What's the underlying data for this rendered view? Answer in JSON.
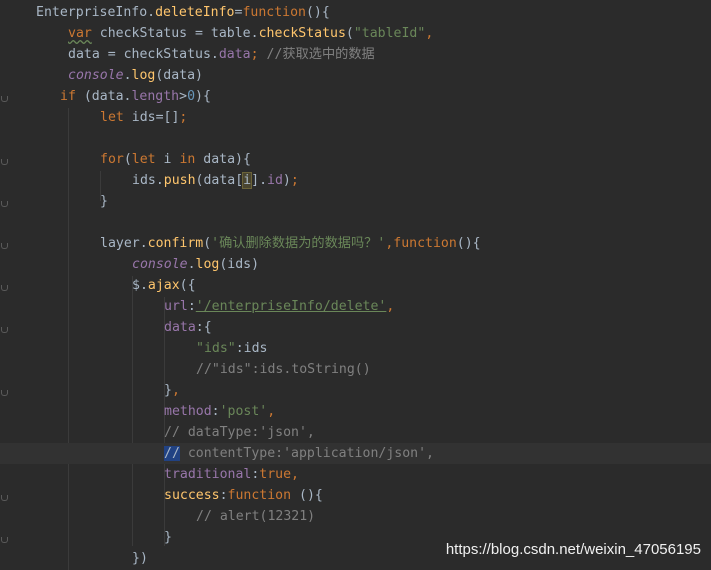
{
  "editor": {
    "lines": [
      {
        "indent": 36,
        "tokens": [
          [
            "t",
            "EnterpriseInfo."
          ],
          [
            "fn",
            "deleteInfo"
          ],
          [
            "t",
            "="
          ],
          [
            "kw",
            "function"
          ],
          [
            "t",
            "(){"
          ]
        ]
      },
      {
        "indent": 68,
        "tokens": [
          [
            "kwsq",
            "var"
          ],
          [
            "t",
            " checkStatus = table."
          ],
          [
            "fn",
            "checkStatus"
          ],
          [
            "t",
            "("
          ],
          [
            "str",
            "\"tableId\""
          ],
          [
            "kw",
            ","
          ]
        ]
      },
      {
        "indent": 68,
        "tokens": [
          [
            "t",
            "data = checkStatus."
          ],
          [
            "prop",
            "data"
          ],
          [
            "kw",
            ";"
          ],
          [
            "cm",
            " //获取选中的数据"
          ]
        ]
      },
      {
        "indent": 68,
        "tokens": [
          [
            "obj",
            "console"
          ],
          [
            "t",
            "."
          ],
          [
            "fn",
            "log"
          ],
          [
            "t",
            "(data)"
          ]
        ]
      },
      {
        "indent": 60,
        "tokens": [
          [
            "kw",
            "if"
          ],
          [
            "t",
            " (data."
          ],
          [
            "prop",
            "length"
          ],
          [
            "t",
            ">"
          ],
          [
            "num",
            "0"
          ],
          [
            "t",
            "){"
          ]
        ]
      },
      {
        "indent": 100,
        "tokens": [
          [
            "kw",
            "let"
          ],
          [
            "t",
            " ids=[]"
          ],
          [
            "kw",
            ";"
          ]
        ]
      },
      {
        "indent": 100,
        "tokens": []
      },
      {
        "indent": 100,
        "tokens": [
          [
            "kw",
            "for"
          ],
          [
            "t",
            "("
          ],
          [
            "kw",
            "let"
          ],
          [
            "t",
            " i "
          ],
          [
            "kw",
            "in"
          ],
          [
            "t",
            " data){"
          ]
        ]
      },
      {
        "indent": 132,
        "tokens": [
          [
            "t",
            "ids."
          ],
          [
            "fn",
            "push"
          ],
          [
            "t",
            "(data["
          ],
          [
            "seli",
            "i"
          ],
          [
            "t",
            "]."
          ],
          [
            "prop",
            "id"
          ],
          [
            "t",
            ")"
          ],
          [
            "kw",
            ";"
          ]
        ]
      },
      {
        "indent": 100,
        "tokens": [
          [
            "t",
            "}"
          ]
        ]
      },
      {
        "indent": 100,
        "tokens": []
      },
      {
        "indent": 100,
        "tokens": [
          [
            "t",
            "layer."
          ],
          [
            "fn",
            "confirm"
          ],
          [
            "t",
            "("
          ],
          [
            "str",
            "'确认删除数据为的数据吗？'"
          ],
          [
            "kw",
            ","
          ],
          [
            "kw",
            "function"
          ],
          [
            "t",
            "(){"
          ]
        ]
      },
      {
        "indent": 132,
        "tokens": [
          [
            "obj",
            "console"
          ],
          [
            "t",
            "."
          ],
          [
            "fn",
            "log"
          ],
          [
            "t",
            "(ids)"
          ]
        ]
      },
      {
        "indent": 132,
        "tokens": [
          [
            "t",
            "$."
          ],
          [
            "fn",
            "ajax"
          ],
          [
            "t",
            "({"
          ]
        ]
      },
      {
        "indent": 164,
        "tokens": [
          [
            "prop",
            "url"
          ],
          [
            "t",
            ":"
          ],
          [
            "strund",
            "'/enterpriseInfo/delete'"
          ],
          [
            "kw",
            ","
          ]
        ]
      },
      {
        "indent": 164,
        "tokens": [
          [
            "prop",
            "data"
          ],
          [
            "t",
            ":{"
          ]
        ]
      },
      {
        "indent": 196,
        "tokens": [
          [
            "str",
            "\"ids\""
          ],
          [
            "t",
            ":ids"
          ]
        ]
      },
      {
        "indent": 196,
        "tokens": [
          [
            "cm",
            "//\"ids\":ids.toString()"
          ]
        ]
      },
      {
        "indent": 164,
        "tokens": [
          [
            "t",
            "}"
          ],
          [
            "kw",
            ","
          ]
        ]
      },
      {
        "indent": 164,
        "tokens": [
          [
            "prop",
            "method"
          ],
          [
            "t",
            ":"
          ],
          [
            "str",
            "'post'"
          ],
          [
            "kw",
            ","
          ]
        ]
      },
      {
        "indent": 164,
        "tokens": [
          [
            "cm",
            "// dataType:'json',"
          ]
        ]
      },
      {
        "indent": 164,
        "hl": true,
        "tokens": [
          [
            "selc",
            "//"
          ],
          [
            "cm",
            " contentType:'application/json',"
          ]
        ]
      },
      {
        "indent": 164,
        "tokens": [
          [
            "prop",
            "traditional"
          ],
          [
            "t",
            ":"
          ],
          [
            "kw",
            "true,"
          ]
        ]
      },
      {
        "indent": 164,
        "tokens": [
          [
            "fn",
            "success"
          ],
          [
            "t",
            ":"
          ],
          [
            "kw",
            "function"
          ],
          [
            "t",
            " (){"
          ]
        ]
      },
      {
        "indent": 196,
        "tokens": [
          [
            "cm",
            "// alert(12321)"
          ]
        ]
      },
      {
        "indent": 164,
        "tokens": [
          [
            "t",
            "}"
          ]
        ]
      },
      {
        "indent": 132,
        "tokens": [
          [
            "t",
            "})"
          ]
        ]
      }
    ]
  },
  "watermark": {
    "text": "https://blog.csdn.net/weixin_47056195"
  }
}
